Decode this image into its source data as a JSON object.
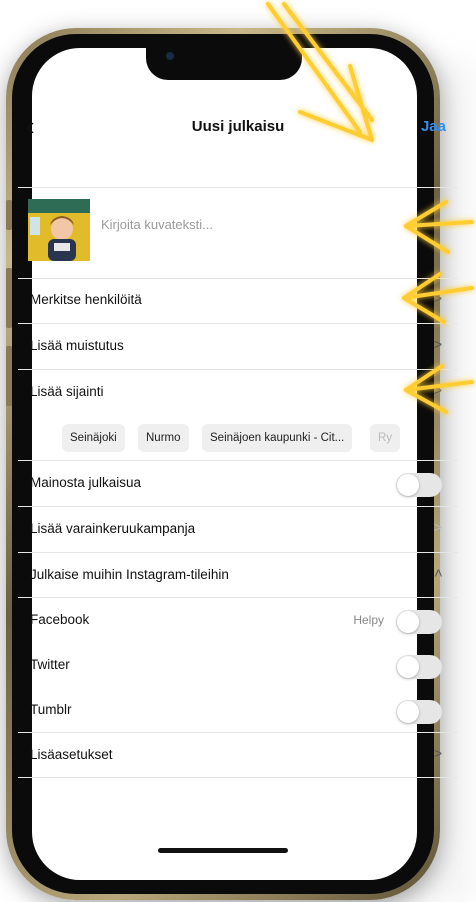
{
  "header": {
    "back_icon": "chevron-left-icon",
    "title": "Uusi julkaisu",
    "share_label": "Jaa"
  },
  "caption": {
    "placeholder": "Kirjoita kuvateksti..."
  },
  "rows": {
    "tag_people": "Merkitse henkilöitä",
    "add_reminder": "Lisää muistutus",
    "add_location": "Lisää sijainti",
    "promote": "Mainosta julkaisua",
    "fundraiser": "Lisää varainkeruukampanja",
    "share_accounts": "Julkaise muihin Instagram-tileihin",
    "facebook": "Facebook",
    "facebook_hint": "Helpy",
    "twitter": "Twitter",
    "tumblr": "Tumblr",
    "advanced": "Lisäasetukset"
  },
  "location_chips": [
    "Seinäjoki",
    "Nurmo",
    "Seinäjoen kaupunki - Cit...",
    "Ry"
  ],
  "toggles": {
    "promote": false,
    "facebook": false,
    "twitter": false,
    "tumblr": false
  },
  "colors": {
    "accent": "#2f8ff0",
    "annotation_arrow": "#ffcc33"
  }
}
